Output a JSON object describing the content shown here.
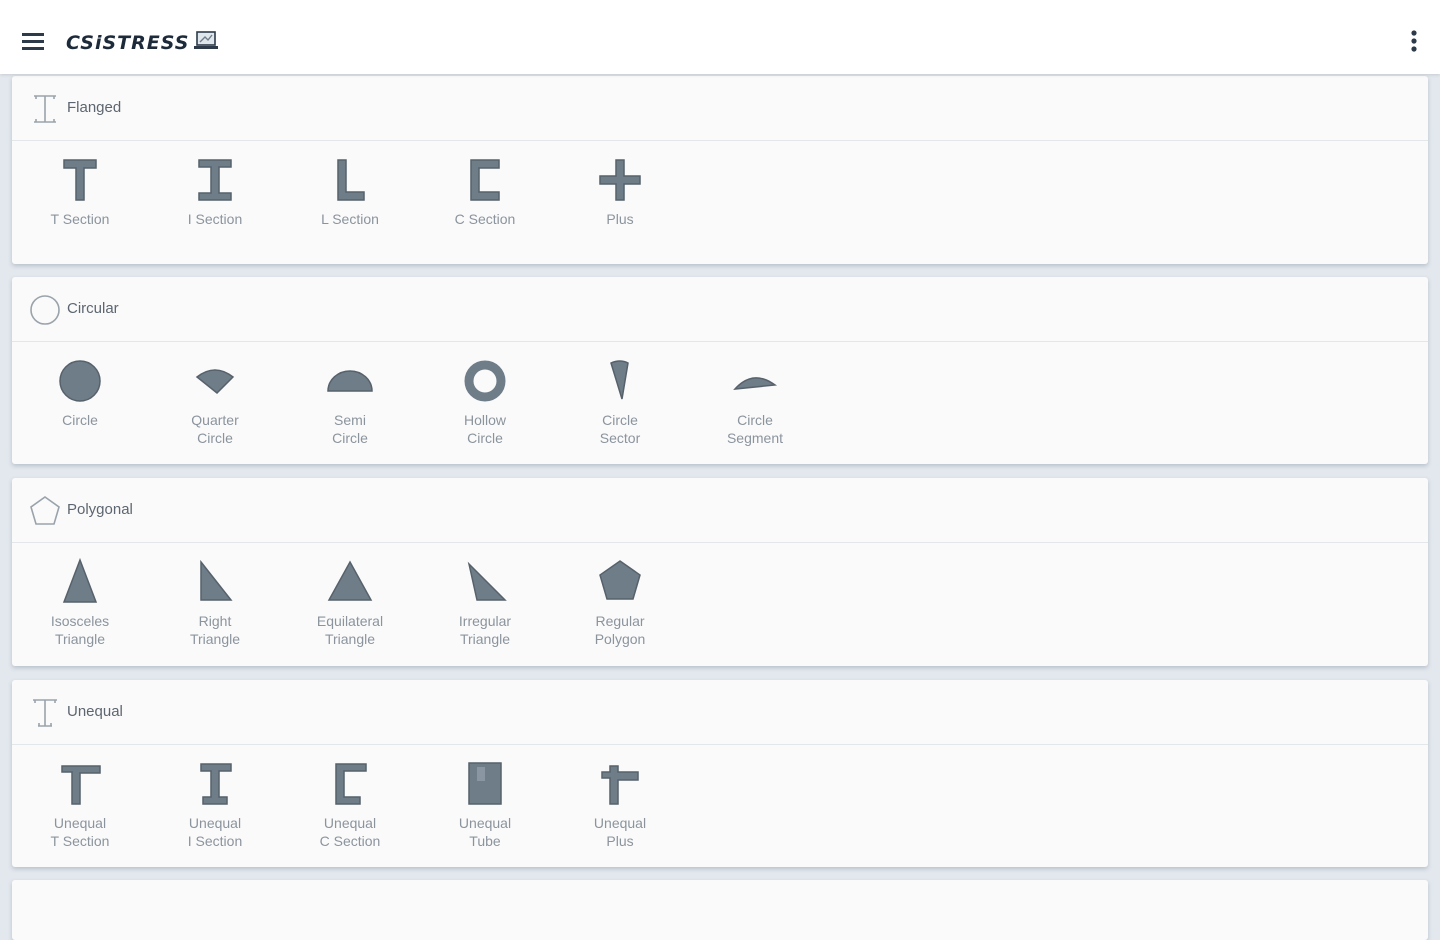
{
  "app": {
    "logo_text": "CSiSTRESS",
    "menu_icon": "hamburger-menu-icon",
    "overflow_icon": "more-vertical-icon",
    "logo_icon": "laptop-icon"
  },
  "colors": {
    "shape_fill": "#6f7d89",
    "label_text": "#8b949d",
    "background": "#e3e8ee"
  },
  "categories": [
    {
      "title": "Flanged",
      "icon": "i-beam-outline-icon",
      "items": [
        {
          "label": "T Section",
          "icon": "t-section-icon"
        },
        {
          "label": "I Section",
          "icon": "i-section-icon"
        },
        {
          "label": "L Section",
          "icon": "l-section-icon"
        },
        {
          "label": "C Section",
          "icon": "c-section-icon"
        },
        {
          "label": "Plus",
          "icon": "plus-section-icon"
        }
      ]
    },
    {
      "title": "Circular",
      "icon": "circle-outline-icon",
      "items": [
        {
          "label": "Circle",
          "icon": "circle-shape-icon"
        },
        {
          "label": "Quarter\nCircle",
          "icon": "quarter-circle-icon"
        },
        {
          "label": "Semi\nCircle",
          "icon": "semi-circle-icon"
        },
        {
          "label": "Hollow\nCircle",
          "icon": "hollow-circle-icon"
        },
        {
          "label": "Circle\nSector",
          "icon": "circle-sector-icon"
        },
        {
          "label": "Circle\nSegment",
          "icon": "circle-segment-icon"
        }
      ]
    },
    {
      "title": "Polygonal",
      "icon": "pentagon-outline-icon",
      "items": [
        {
          "label": "Isosceles\nTriangle",
          "icon": "isosceles-triangle-icon"
        },
        {
          "label": "Right\nTriangle",
          "icon": "right-triangle-icon"
        },
        {
          "label": "Equilateral\nTriangle",
          "icon": "equilateral-triangle-icon"
        },
        {
          "label": "Irregular\nTriangle",
          "icon": "irregular-triangle-icon"
        },
        {
          "label": "Regular\nPolygon",
          "icon": "regular-polygon-icon"
        }
      ]
    },
    {
      "title": "Unequal",
      "icon": "unequal-beam-outline-icon",
      "items": [
        {
          "label": "Unequal\nT Section",
          "icon": "unequal-t-section-icon"
        },
        {
          "label": "Unequal\nI Section",
          "icon": "unequal-i-section-icon"
        },
        {
          "label": "Unequal\nC Section",
          "icon": "unequal-c-section-icon"
        },
        {
          "label": "Unequal\nTube",
          "icon": "unequal-tube-icon"
        },
        {
          "label": "Unequal\nPlus",
          "icon": "unequal-plus-icon"
        }
      ]
    }
  ]
}
